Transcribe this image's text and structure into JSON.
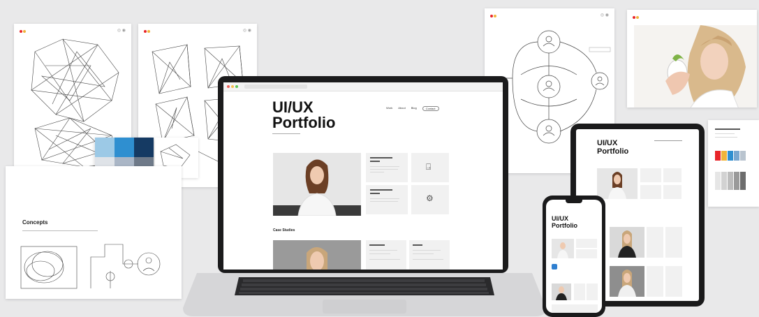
{
  "laptop": {
    "title_line1": "UI/UX",
    "title_line2": "Portfolio",
    "section_heading": "Case Studies",
    "nav": [
      "Work",
      "About",
      "Blog",
      "Contact"
    ]
  },
  "tablet": {
    "title_line1": "UI/UX",
    "title_line2": "Portfolio"
  },
  "phone": {
    "title_line1": "UI/UX",
    "title_line2": "Portfolio"
  },
  "concepts_card": {
    "title": "Concepts"
  },
  "palette_colors": [
    "#9cc9e6",
    "#2f8fd0",
    "#153a63",
    "#dfe3e8",
    "#aab6c6",
    "#6f7a89",
    "#f0d2cf",
    "#e78f8b",
    "#4a5d74",
    "#f4c1bb",
    "#e8252a",
    "#0f3d6f"
  ],
  "swatches": [
    "#e8252a",
    "#f0b43a",
    "#2f8fd0",
    "#7aa7cf",
    "#b9c4cf"
  ],
  "grays": [
    "#e6e6e6",
    "#d2d2d2",
    "#bdbdbd",
    "#9a9a9a",
    "#6d6d6d"
  ]
}
